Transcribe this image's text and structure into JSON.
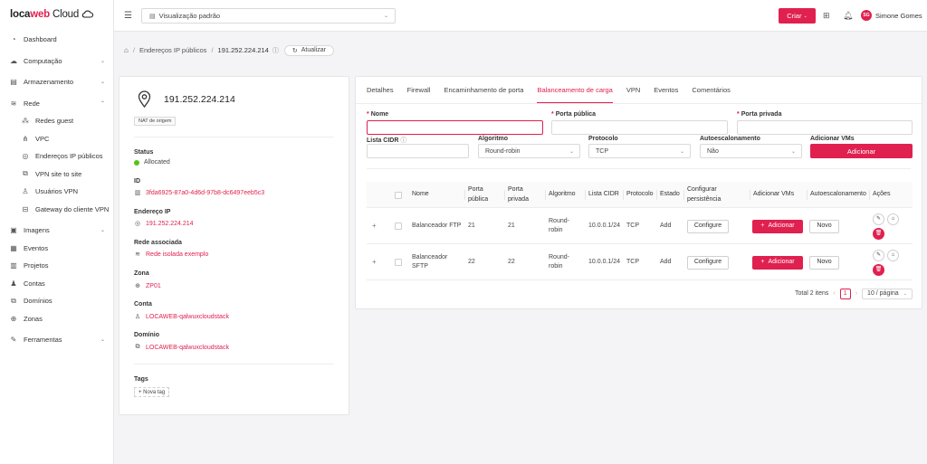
{
  "brand": {
    "part1": "loca",
    "part2": "web",
    "part3": "Cloud"
  },
  "sidebar": {
    "items": [
      {
        "label": "Dashboard",
        "icon": "dashboard-icon"
      },
      {
        "label": "Computação",
        "icon": "cloud-icon",
        "chevron": "down"
      },
      {
        "label": "Armazenamento",
        "icon": "storage-icon",
        "chevron": "down"
      },
      {
        "label": "Rede",
        "icon": "wifi-icon",
        "chevron": "up"
      },
      {
        "label": "Redes guest",
        "icon": "network-icon",
        "sub": true
      },
      {
        "label": "VPC",
        "icon": "vpc-icon",
        "sub": true
      },
      {
        "label": "Endereços IP públicos",
        "icon": "location-icon",
        "sub": true
      },
      {
        "label": "VPN site to site",
        "icon": "vpn-icon",
        "sub": true
      },
      {
        "label": "Usuários VPN",
        "icon": "user-icon",
        "sub": true
      },
      {
        "label": "Gateway do cliente VPN",
        "icon": "gateway-icon",
        "sub": true
      },
      {
        "label": "Imagens",
        "icon": "image-icon",
        "chevron": "down"
      },
      {
        "label": "Eventos",
        "icon": "events-icon"
      },
      {
        "label": "Projetos",
        "icon": "projects-icon"
      },
      {
        "label": "Contas",
        "icon": "accounts-icon"
      },
      {
        "label": "Domínios",
        "icon": "domains-icon"
      },
      {
        "label": "Zonas",
        "icon": "globe-icon"
      },
      {
        "label": "Ferramentas",
        "icon": "tools-icon",
        "chevron": "down"
      }
    ]
  },
  "topbar": {
    "view": "Visualização padrão",
    "create": "Criar",
    "user_initials": "SG",
    "user_name": "Simone Gomes"
  },
  "breadcrumb": {
    "parent": "Endereços IP públicos",
    "current": "191.252.224.214",
    "refresh": "Atualizar"
  },
  "detail": {
    "ip": "191.252.224.214",
    "tag": "NAT de origem",
    "status_label": "Status",
    "status_value": "Allocated",
    "id_label": "ID",
    "id_value": "3fda6925-87a0-4d6d-97b8-dc6497eeb5c3",
    "address_label": "Endereço IP",
    "address_value": "191.252.224.214",
    "network_label": "Rede associada",
    "network_value": "Rede isolada exemplo",
    "zone_label": "Zona",
    "zone_value": "ZP01",
    "account_label": "Conta",
    "account_value": "LOCAWEB-qalwuxcloudstack",
    "domain_label": "Domínio",
    "domain_value": "LOCAWEB-qalwuxcloudstack",
    "tags_label": "Tags",
    "new_tag": "+ Nova tag"
  },
  "tabs": [
    "Detalhes",
    "Firewall",
    "Encaminhamento de porta",
    "Balanceamento de carga",
    "VPN",
    "Eventos",
    "Comentários"
  ],
  "active_tab": 3,
  "form": {
    "name_label": "Nome",
    "public_port_label": "Porta pública",
    "private_port_label": "Porta privada",
    "cidr_label": "Lista CIDR",
    "algorithm_label": "Algoritmo",
    "algorithm_value": "Round-robin",
    "protocol_label": "Protocolo",
    "protocol_value": "TCP",
    "autoscale_label": "Autoescalonamento",
    "autoscale_value": "Não",
    "add_vms_label": "Adicionar VMs",
    "add_button": "Adicionar"
  },
  "table": {
    "headers": {
      "name": "Nome",
      "public_port_1": "Porta",
      "public_port_2": "pública",
      "private_port_1": "Porta",
      "private_port_2": "privada",
      "algorithm": "Algoritmo",
      "cidr": "Lista CIDR",
      "protocol": "Protocolo",
      "state": "Estado",
      "persist_1": "Configurar",
      "persist_2": "persistência",
      "add_vms": "Adicionar VMs",
      "autoscale": "Autoescalonamento",
      "actions": "Ações"
    },
    "rows": [
      {
        "name_1": "Balanceador FTP",
        "name_2": "",
        "public_port": "21",
        "private_port": "21",
        "algo_1": "Round-",
        "algo_2": "robin",
        "cidr": "10.0.0.1/24",
        "protocol": "TCP",
        "state": "Add",
        "configure": "Configure",
        "add": "Adicionar",
        "new": "Novo"
      },
      {
        "name_1": "Balanceador",
        "name_2": "SFTP",
        "public_port": "22",
        "private_port": "22",
        "algo_1": "Round-",
        "algo_2": "robin",
        "cidr": "10.0.0.1/24",
        "protocol": "TCP",
        "state": "Add",
        "configure": "Configure",
        "add": "Adicionar",
        "new": "Novo"
      }
    ]
  },
  "pagination": {
    "total": "Total 2 itens",
    "page": "1",
    "page_size": "10 / página"
  },
  "colors": {
    "accent": "#e0204f",
    "success": "#52c41a"
  }
}
